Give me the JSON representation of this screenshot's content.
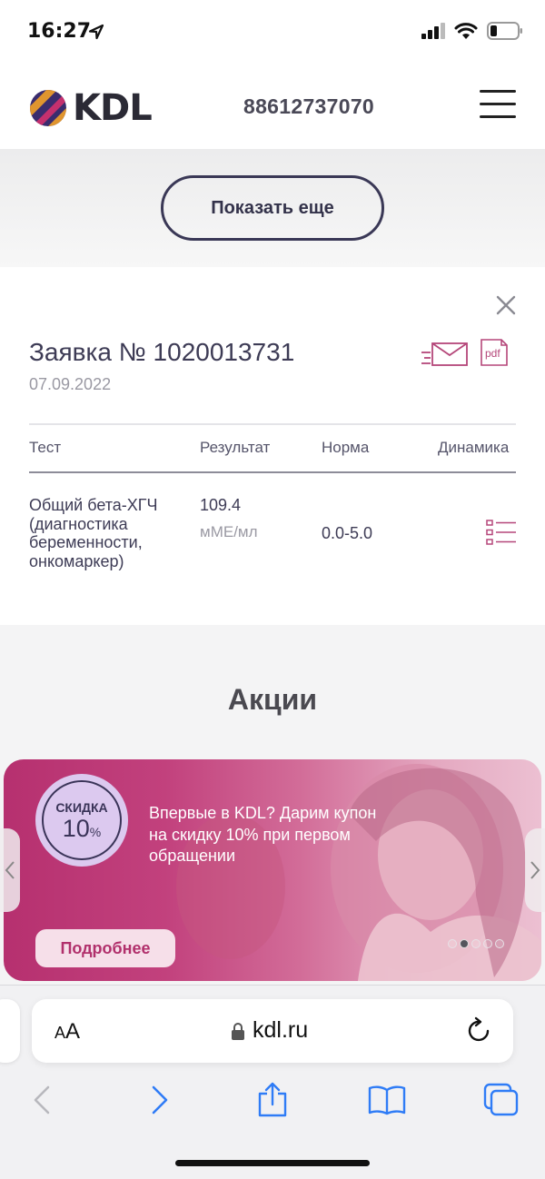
{
  "status_bar": {
    "time": "16:27"
  },
  "header": {
    "logo_text": "KDL",
    "phone": "88612737070"
  },
  "show_more": {
    "label": "Показать еще"
  },
  "order": {
    "title": "Заявка № 1020013731",
    "date": "07.09.2022",
    "pdf_label": "pdf",
    "columns": {
      "test": "Тест",
      "result": "Результат",
      "norm": "Норма",
      "dynamics": "Динамика"
    },
    "row": {
      "test_lines": [
        "Общий бета-ХГЧ",
        "(диагностика",
        "беременности,",
        "онкомаркер)"
      ],
      "result": "109.4",
      "unit": "мМЕ/мл",
      "norm": "0.0-5.0"
    }
  },
  "promotions": {
    "title": "Акции",
    "banner": {
      "discount_label": "СКИДКА",
      "discount_value": "10",
      "discount_unit": "%",
      "text": "Впервые в KDL? Дарим купон на скидку 10% при первом обращении",
      "button": "Подробнее",
      "slides_count": 5,
      "active_slide": 2
    }
  },
  "browser": {
    "text_size_label": "AA",
    "url": "kdl.ru"
  },
  "colors": {
    "brand_dark": "#3a3856",
    "brand_pink": "#b1306c",
    "icon_pink": "#b5477a"
  }
}
